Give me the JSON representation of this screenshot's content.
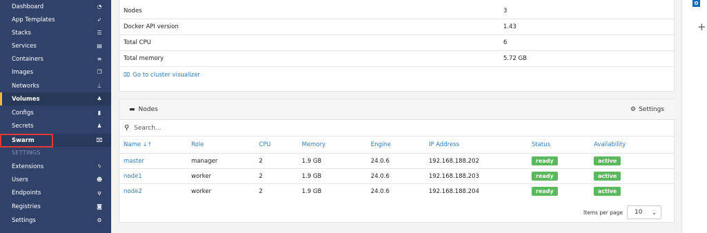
{
  "sidebar": {
    "items": [
      {
        "label": "Dashboard",
        "icon": "tachometer-icon",
        "glyph": "◔"
      },
      {
        "label": "App Templates",
        "icon": "rocket-icon",
        "glyph": "➶"
      },
      {
        "label": "Stacks",
        "icon": "list-icon",
        "glyph": "☰"
      },
      {
        "label": "Services",
        "icon": "services-icon",
        "glyph": "▤"
      },
      {
        "label": "Containers",
        "icon": "server-icon",
        "glyph": "≡"
      },
      {
        "label": "Images",
        "icon": "clone-icon",
        "glyph": "❐"
      },
      {
        "label": "Networks",
        "icon": "sitemap-icon",
        "glyph": "⊥"
      },
      {
        "label": "Volumes",
        "icon": "cubes-icon",
        "glyph": "♣"
      },
      {
        "label": "Configs",
        "icon": "file-code-icon",
        "glyph": "▮"
      },
      {
        "label": "Secrets",
        "icon": "user-secret-icon",
        "glyph": "♟"
      },
      {
        "label": "Swarm",
        "icon": "object-group-icon",
        "glyph": "⌧"
      }
    ],
    "settings_header": "SETTINGS",
    "settings_items": [
      {
        "label": "Extensions",
        "icon": "bolt-icon",
        "glyph": "ϟ"
      },
      {
        "label": "Users",
        "icon": "users-icon",
        "glyph": "☻"
      },
      {
        "label": "Endpoints",
        "icon": "plug-icon",
        "glyph": "ψ"
      },
      {
        "label": "Registries",
        "icon": "database-icon",
        "glyph": "◙"
      },
      {
        "label": "Settings",
        "icon": "cogs-icon",
        "glyph": "⚙"
      }
    ]
  },
  "info": {
    "rows": [
      {
        "key": "Nodes",
        "value": "3"
      },
      {
        "key": "Docker API version",
        "value": "1.43"
      },
      {
        "key": "Total CPU",
        "value": "6"
      },
      {
        "key": "Total memory",
        "value": "5.72 GB"
      }
    ],
    "visualizer_link": "Go to cluster visualizer"
  },
  "nodes": {
    "title": "Nodes",
    "settings_label": "Settings",
    "search_placeholder": "Search...",
    "columns": [
      "Name",
      "Role",
      "CPU",
      "Memory",
      "Engine",
      "IP Address",
      "Status",
      "Availability"
    ],
    "rows": [
      {
        "name": "master",
        "role": "manager",
        "cpu": "2",
        "memory": "1.9 GB",
        "engine": "24.0.6",
        "ip": "192.168.188.202",
        "status": "ready",
        "availability": "active"
      },
      {
        "name": "node1",
        "role": "worker",
        "cpu": "2",
        "memory": "1.9 GB",
        "engine": "24.0.6",
        "ip": "192.168.188.203",
        "status": "ready",
        "availability": "active"
      },
      {
        "name": "node2",
        "role": "worker",
        "cpu": "2",
        "memory": "1.9 GB",
        "engine": "24.0.6",
        "ip": "192.168.188.204",
        "status": "ready",
        "availability": "active"
      }
    ],
    "items_per_page_label": "Items per page",
    "items_per_page_value": "10"
  },
  "rail": {
    "outlook_letter": "O",
    "plus": "+"
  },
  "colors": {
    "sidebar": "#30426a",
    "accent": "#337ab7",
    "badge": "#5cb85c",
    "highlight": "#e53935"
  }
}
